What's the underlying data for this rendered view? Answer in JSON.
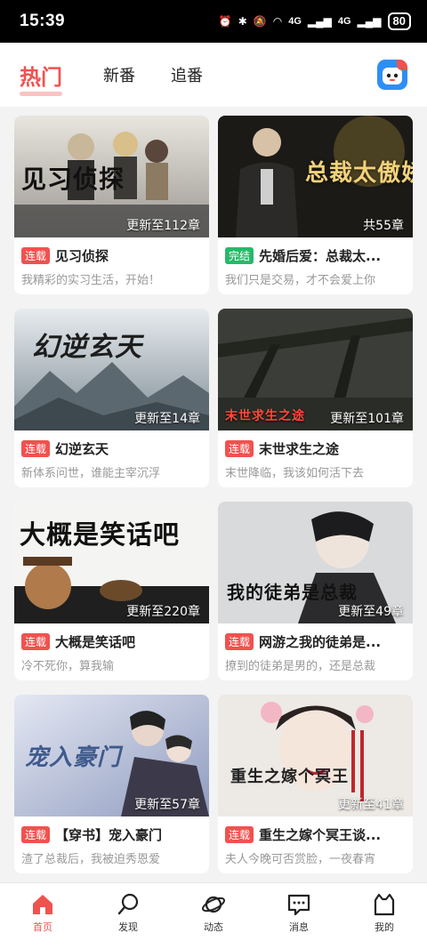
{
  "status_bar": {
    "time": "15:39",
    "net1": "4G",
    "net2": "4G",
    "battery": "80"
  },
  "tabs": [
    {
      "label": "热门",
      "active": true
    },
    {
      "label": "新番",
      "active": false
    },
    {
      "label": "追番",
      "active": false
    }
  ],
  "cards": [
    {
      "cover_title": "见习侦探",
      "update": "更新至112章",
      "status": "连载",
      "title": "见习侦探",
      "desc": "我精彩的实习生活，开始！"
    },
    {
      "cover_title": "总裁太傲娇",
      "update": "共55章",
      "status": "完结",
      "title": "先婚后爱：总裁太...",
      "desc": "我们只是交易，才不会爱上你"
    },
    {
      "cover_title": "幻逆玄天",
      "update": "更新至14章",
      "status": "连载",
      "title": "幻逆玄天",
      "desc": "新体系问世，谁能主宰沉浮"
    },
    {
      "cover_title": "末世求生之途",
      "update": "更新至101章",
      "status": "连载",
      "title": "末世求生之途",
      "desc": "末世降临，我该如何活下去"
    },
    {
      "cover_title": "大概是笑话吧",
      "update": "更新至220章",
      "status": "连载",
      "title": "大概是笑话吧",
      "desc": "冷不死你，算我输"
    },
    {
      "cover_title": "我的徒弟是总裁",
      "update": "更新至49章",
      "status": "连载",
      "title": "网游之我的徒弟是...",
      "desc": "撩到的徒弟是男的，还是总裁"
    },
    {
      "cover_title": "宠入豪门",
      "update": "更新至57章",
      "status": "连载",
      "title": "【穿书】宠入豪门",
      "desc": "渣了总裁后，我被迫秀恩爱"
    },
    {
      "cover_title": "重生之嫁个冥王",
      "update": "更新至41章",
      "status": "连载",
      "title": "重生之嫁个冥王谈...",
      "desc": "夫人今晚可否赏脸，一夜春宵"
    }
  ],
  "nav": [
    {
      "label": "首页",
      "icon": "home-icon",
      "active": true
    },
    {
      "label": "发现",
      "icon": "discover-icon",
      "active": false
    },
    {
      "label": "动态",
      "icon": "planet-icon",
      "active": false
    },
    {
      "label": "消息",
      "icon": "message-icon",
      "active": false
    },
    {
      "label": "我的",
      "icon": "profile-icon",
      "active": false
    }
  ],
  "colors": {
    "accent": "#f0524f",
    "done": "#27b96a"
  }
}
